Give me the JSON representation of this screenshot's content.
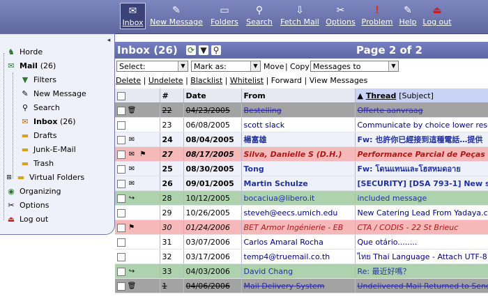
{
  "toolbar": [
    {
      "icon": "inbox-icon",
      "label": "Inbox",
      "active": true
    },
    {
      "icon": "new-message-icon",
      "label": "New Message"
    },
    {
      "icon": "folders-icon",
      "label": "Folders"
    },
    {
      "icon": "search-icon",
      "label": "Search"
    },
    {
      "icon": "fetch-mail-icon",
      "label": "Fetch Mail"
    },
    {
      "icon": "options-icon",
      "label": "Options"
    },
    {
      "icon": "problem-icon",
      "label": "Problem"
    },
    {
      "icon": "help-icon",
      "label": "Help"
    },
    {
      "icon": "logout-icon",
      "label": "Log out"
    }
  ],
  "sidebar": {
    "horde": "Horde",
    "mail": "Mail",
    "mail_count": "(26)",
    "filters": "Filters",
    "new_message": "New Message",
    "search": "Search",
    "inbox": "Inbox",
    "inbox_count": "(26)",
    "drafts": "Drafts",
    "junk": "Junk-E-Mail",
    "trash": "Trash",
    "virtual": "Virtual Folders",
    "organizing": "Organizing",
    "options": "Options",
    "logout": "Log out"
  },
  "main": {
    "title": "Inbox (26)",
    "page": "Page 2 of 2",
    "select_value": "Select:",
    "mark_value": "Mark as:",
    "move_label": "Move",
    "copy_label": "Copy",
    "target_value": "Messages to",
    "separator": "|",
    "actions": [
      "Delete",
      "Undelete",
      "Blacklist",
      "Whitelist",
      "Forward",
      "View Messages"
    ]
  },
  "columns": {
    "num": "#",
    "date": "Date",
    "from": "From",
    "thread": "Thread",
    "subject": "[Subject]",
    "sort_arrow": "▲"
  },
  "messages": [
    {
      "num": "22",
      "date": "04/23/2005",
      "from": "Bestelling",
      "subject": "Offerte aanvraag",
      "style": "deleted",
      "icons": [
        "trash"
      ]
    },
    {
      "num": "23",
      "date": "06/08/2005",
      "from": "scott slack",
      "subject": "Communicate by choice lower rese",
      "style": "plain",
      "icons": []
    },
    {
      "num": "24",
      "date": "08/04/2005",
      "from": "楊富雄",
      "subject": "Fw: 也許你已經接到這種電話…提供",
      "style": "alt unread",
      "icons": [
        "envelope"
      ]
    },
    {
      "num": "27",
      "date": "08/17/2005",
      "from": "Silva, Danielle S (D.H.)",
      "subject": "Performance Parcial de Peças - Ju",
      "style": "flagged unread italic",
      "icons": [
        "envelope",
        "flag"
      ]
    },
    {
      "num": "25",
      "date": "08/30/2005",
      "from": "Tong",
      "subject": "Fw: โดนแทนและโฮสหมดอาย",
      "style": "alt unread",
      "icons": [
        "envelope"
      ]
    },
    {
      "num": "26",
      "date": "09/01/2005",
      "from": "Martin Schulze",
      "subject": "[SECURITY] [DSA 793-1] New sqwe",
      "style": "alt unread",
      "icons": [
        "envelope"
      ]
    },
    {
      "num": "28",
      "date": "10/12/2005",
      "from": "bocaciua@libero.it",
      "subject": "included message",
      "style": "green",
      "icons": [
        "forward"
      ]
    },
    {
      "num": "29",
      "date": "10/26/2005",
      "from": "steveh@eecs.umich.edu",
      "subject": "New Catering Lead From Yadaya.co",
      "style": "plain",
      "icons": []
    },
    {
      "num": "30",
      "date": "01/24/2006",
      "from": "BET Armor Ingénierie - EB",
      "subject": "CTA / CODIS - 22 St Brieuc",
      "style": "flagged italic",
      "icons": [
        "flag"
      ]
    },
    {
      "num": "31",
      "date": "03/07/2006",
      "from": "Carlos Amaral Rocha",
      "subject": "Que otário........",
      "style": "plain",
      "icons": []
    },
    {
      "num": "32",
      "date": "03/17/2006",
      "from": "temp4@truemail.co.th",
      "subject": "ไทย Thai Language - Attach UTF-8 c",
      "style": "plain",
      "icons": []
    },
    {
      "num": "33",
      "date": "04/03/2006",
      "from": "David Chang",
      "subject": "Re: 最近好嗎？",
      "style": "green",
      "icons": [
        "forward"
      ]
    },
    {
      "num": "1",
      "date": "04/06/2006",
      "from": "Mail Delivery System",
      "subject": "Undelivered Mail Returned to Sende",
      "style": "deleted",
      "icons": [
        "trash"
      ]
    }
  ]
}
